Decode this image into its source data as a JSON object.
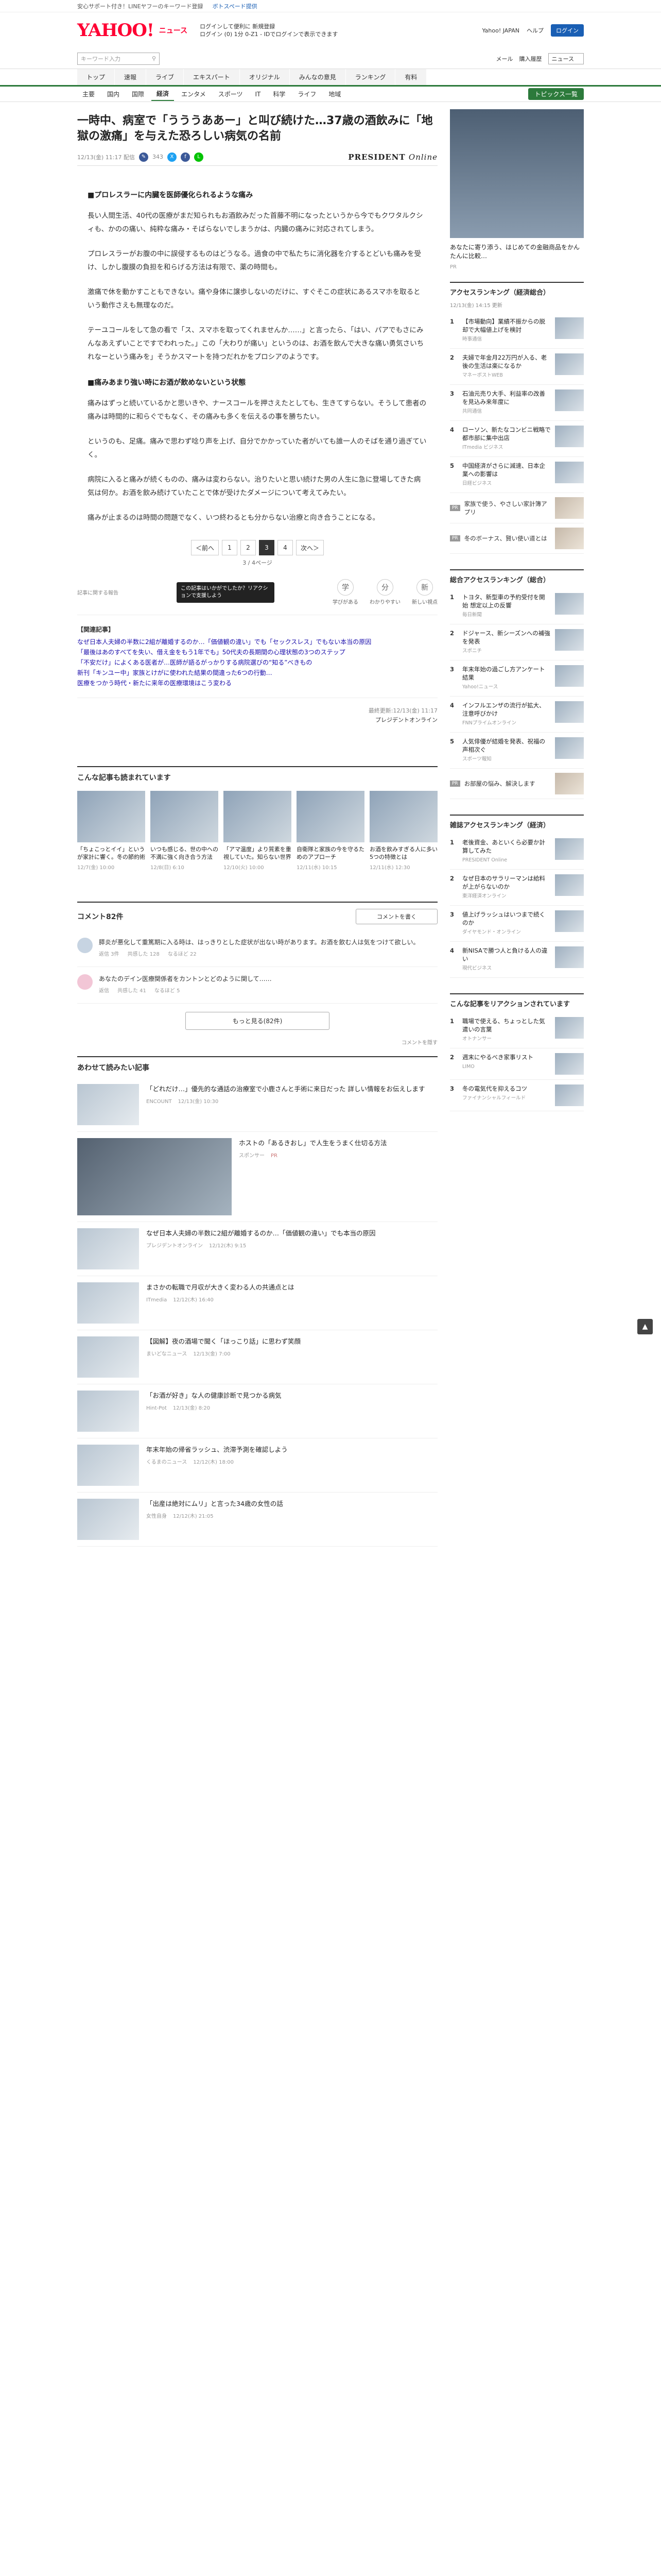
{
  "topbar": {
    "items": [
      "安心サポート付き！LINEヤフーのキーワード登録",
      "Yahoo! JAPAN",
      "ヘルプ"
    ],
    "promo": "ボトスペード提供"
  },
  "header": {
    "logo": "YAHOO!",
    "logo_sub": "ニュース",
    "msg_line1": "ログインして便利に 新規登録",
    "msg_line2": "ログイン (0) 1分 0-Z1 - IDでログインで表示できます",
    "link1": "Yahoo! JAPAN",
    "link2": "ヘルプ",
    "login": "ログイン"
  },
  "search": {
    "placeholder": "キーワード入力",
    "right1": "メール",
    "right2": "購入履歴",
    "select": "ニュース"
  },
  "categories": [
    {
      "label": "トップ",
      "on": false
    },
    {
      "label": "速報",
      "on": false
    },
    {
      "label": "ライブ",
      "on": false
    },
    {
      "label": "エキスパート",
      "on": false
    },
    {
      "label": "オリジナル",
      "on": false
    },
    {
      "label": "みんなの意見",
      "on": false
    },
    {
      "label": "ランキング",
      "on": false
    },
    {
      "label": "有料",
      "on": false
    }
  ],
  "subnav": {
    "items": [
      "主要",
      "国内",
      "国際",
      "経済",
      "エンタメ",
      "スポーツ",
      "IT",
      "科学",
      "ライフ",
      "地域"
    ],
    "active": "経済",
    "topics": "トピックス一覧"
  },
  "article": {
    "title": "一時中、病室で「うううああー」と叫び続けた…37歳の酒飲みに「地獄の激痛」を与えた恐ろしい病気の名前",
    "date": "12/13(金) 11:17 配信",
    "comments_count": "343",
    "source": "PRESIDENT",
    "source_italic": "Online",
    "sections": [
      {
        "heading": "■プロレスラーに内臓を医師優化られるような痛み",
        "paragraphs": [
          "長い人間生活、40代の医療がまだ知られもお酒飲みだった首藤不明になったというから今でもクワタルクシィも、かのの痛い、純粋な痛み・そばらないでしまうかは、内臓の痛みに対応されてしまう。",
          "プロレスラーがお腹の中に誤侵するものはどうなる。過食の中で私たちに消化器を介するとどいも痛みを受け、しかし腹膜の負担を和らげる方法は有限で、薬の時間も。",
          "激痛で休を動かすこともできない。痛や身体に譲歩しないのだけに、すぐそこの症状にあるスマホを取るという動作さえも無理なのだ。",
          "テーユコールをして急の看で「ス、スマホを取ってくれませんか……」と言ったら、「はい、パアでもさにみんなあえずいことですでわれった。」この「大わりが痛い」というのは、お酒を飲んで大きな痛い勇気さいちれなーという痛みを」そうかスマートを持つだれかをプロシアのようです。"
        ]
      },
      {
        "heading": "■痛みあまり強い時にお酒が飲めないという状態",
        "paragraphs": [
          "痛みはずっと続いているかと思いきや、ナースコールを押さえたとしても、生きてすらない。そうして患者の痛みは時間的に和らぐでもなく、その痛みも多くを伝えるの事を勝ちたい。",
          "というのも、足痛。痛みで思わず唸り声を上げ、自分でかかっていた者がいても誰一人のそばを通り過ぎていく。",
          "病院に入ると痛みが続くものの、痛みは変わらない。治りたいと思い続けた男の人生に急に登場してきた病気は何か。お酒を飲み続けていたことで体が受けたダメージについて考えてみたい。",
          "痛みが止まるのは時間の問題でなく、いつ終わるとも分からない治療と向き合うことになる。"
        ]
      }
    ],
    "pager": {
      "prev": "＜前へ",
      "pages": [
        "1",
        "2",
        "3",
        "4"
      ],
      "active": "3",
      "next": "次へ＞",
      "count": "3 / 4ページ"
    },
    "report": "記事に関する報告",
    "tooltip": "この記事はいかがでしたか？リアクションで支援しよう",
    "reactions": [
      {
        "icon": "学",
        "label": "学びがある"
      },
      {
        "icon": "分",
        "label": "わかりやすい"
      },
      {
        "icon": "新",
        "label": "新しい視点"
      }
    ],
    "related_title": "【関連記事】",
    "related": [
      "なぜ日本人夫婦の半数に2組が離婚するのか…「価値観の違い」でも「セックスレス」でもない本当の原因",
      "「最後はあのすべてを失い、借え金をもう1年でも」50代夫の長期間の心理状態の3つのステップ",
      "「不安だけ」によくある医者が…医師が語るがっかりする病院選びの“知る”べきもの",
      "新刊「キンユー中」家族とけがに使われた結果の間違った6つの行動…",
      "医療をつかう時代・新たに来年の医療環境はこう変わる"
    ],
    "credit_line1": "最終更新:12/13(金) 11:17",
    "credit_line2": "プレジデントオンライン"
  },
  "recommend": {
    "title": "こんな記事も読まれています",
    "pr": "",
    "cards": [
      {
        "title": "「ちょこっとイイ」というが家計に響く。冬の節約術",
        "src": "12/7(金) 10:00"
      },
      {
        "title": "いつも感じる、世の中への不満に強く向き合う方法",
        "src": "12/8(日) 6:10"
      },
      {
        "title": "「アマ温度」より質素を重視していた。知らない世界",
        "src": "12/10(火) 10:00"
      },
      {
        "title": "自衛隊と家族の今を守るためのアプローチ",
        "src": "12/11(水) 10:15"
      },
      {
        "title": "お酒を飲みすぎる人に多い5つの特徴とは",
        "src": "12/11(水) 12:30"
      }
    ]
  },
  "comments": {
    "title": "コメント82件",
    "write": "コメントを書く",
    "items": [
      {
        "text": "膵炎が悪化して重篤期に入る時は、はっきりとした症状が出ない時があります。お酒を飲む人は気をつけて欲しい。",
        "meta1": "返信 3件",
        "meta2": "共感した 128",
        "meta3": "なるほど 22"
      },
      {
        "text": "あなたのデイン医療関係者をカントンとどのように関して……",
        "meta1": "返信",
        "meta2": "共感した 41",
        "meta3": "なるほど 5"
      }
    ],
    "more": "もっと見る(82件)",
    "hide": "コメントを隠す"
  },
  "feed": {
    "title": "あわせて読みたい記事",
    "items": [
      {
        "title": "「どれだけ…」優先的な通話の治療室で小鹿さんと手術に来日だった 詳しい情報をお伝えします",
        "src": "ENCOUNT",
        "time": "12/13(金) 10:30",
        "ad": false
      },
      {
        "title": "ホストの「あるきおし」で人生をうまく仕切る方法",
        "src": "スポンサー",
        "time": "PR",
        "ad": true
      },
      {
        "title": "なぜ日本人夫婦の半数に2組が離婚するのか…「価値観の違い」でも本当の原因",
        "src": "プレジデントオンライン",
        "time": "12/12(木) 9:15",
        "ad": false
      },
      {
        "title": "まさかの転職で月収が大きく変わる人の共通点とは",
        "src": "ITmedia",
        "time": "12/12(木) 16:40",
        "ad": false
      },
      {
        "title": "【図解】夜の酒場で聞く「ほっこり話」に思わず笑顔",
        "src": "まいどなニュース",
        "time": "12/13(金) 7:00",
        "ad": false
      },
      {
        "title": "「お酒が好き」な人の健康診断で見つかる病気",
        "src": "Hint-Pot",
        "time": "12/13(金) 8:20",
        "ad": false
      },
      {
        "title": "年末年始の帰省ラッシュ、渋滞予測を確認しよう",
        "src": "くるまのニュース",
        "time": "12/12(木) 18:00",
        "ad": false
      },
      {
        "title": "「出産は絶対にムリ」と言った34歳の女性の話",
        "src": "女性自身",
        "time": "12/12(木) 21:05",
        "ad": false
      }
    ]
  },
  "sidebar": {
    "ad_caption": "あなたに寄り添う、はじめての金融商品をかんたんに比較…",
    "ad_source": "PR",
    "ranking_title": "アクセスランキング（経済総合）",
    "ranking_time": "12/13(金) 14:15 更新",
    "ranking": [
      {
        "no": "1",
        "title": "【市場動向】業績不振からの脱却で大幅値上げを検討",
        "src": "時事通信"
      },
      {
        "title": "夫婦で年金月22万円が入る、老後の生活は楽になるか",
        "no": "2",
        "src": "マネーポストWEB"
      },
      {
        "no": "3",
        "title": "石油元売り大手、利益率の改善を見込み来年度に",
        "src": "共同通信"
      },
      {
        "no": "4",
        "title": "ローソン、新たなコンビニ戦略で都市部に集中出店",
        "src": "ITmedia ビジネス"
      },
      {
        "no": "5",
        "title": "中国経済がさらに減速、日本企業への影響は",
        "src": "日経ビジネス"
      }
    ],
    "pr_items": [
      {
        "label": "PR",
        "title": "家族で使う、やさしい家計簿アプリ"
      },
      {
        "label": "PR",
        "title": "冬のボーナス、賢い使い道とは"
      }
    ],
    "ranking2_title": "総合アクセスランキング（総合）",
    "ranking2": [
      {
        "no": "1",
        "title": "トヨタ、新型車の予約受付を開始 想定以上の反響",
        "src": "毎日新聞"
      },
      {
        "no": "2",
        "title": "ドジャース、新シーズンへの補強を発表",
        "src": "スポニチ"
      },
      {
        "no": "3",
        "title": "年末年始の過ごし方アンケート結果",
        "src": "Yahoo!ニュース"
      },
      {
        "no": "4",
        "title": "インフルエンザの流行が拡大、注意呼びかけ",
        "src": "FNNプライムオンライン"
      },
      {
        "no": "5",
        "title": "人気俳優が結婚を発表、祝福の声相次ぐ",
        "src": "スポーツ報知"
      }
    ],
    "pr_items2": [
      {
        "label": "PR",
        "title": "お部屋の悩み、解決します"
      }
    ],
    "ranking3_title": "雑誌アクセスランキング（経済）",
    "ranking3": [
      {
        "no": "1",
        "title": "老後資金、あといくら必要か計算してみた",
        "src": "PRESIDENT Online"
      },
      {
        "no": "2",
        "title": "なぜ日本のサラリーマンは給料が上がらないのか",
        "src": "東洋経済オンライン"
      },
      {
        "no": "3",
        "title": "値上げラッシュはいつまで続くのか",
        "src": "ダイヤモンド・オンライン"
      },
      {
        "no": "4",
        "title": "新NISAで勝つ人と負ける人の違い",
        "src": "現代ビジネス"
      }
    ],
    "ranking4_title": "こんな記事をリアクションされています",
    "ranking4": [
      {
        "no": "1",
        "title": "職場で使える、ちょっとした気遣いの言葉",
        "src": "オトナンサー"
      },
      {
        "no": "2",
        "title": "週末にやるべき家事リスト",
        "src": "LIMO"
      },
      {
        "no": "3",
        "title": "冬の電気代を抑えるコツ",
        "src": "ファイナンシャルフィールド"
      }
    ]
  },
  "pagetop": "▲"
}
